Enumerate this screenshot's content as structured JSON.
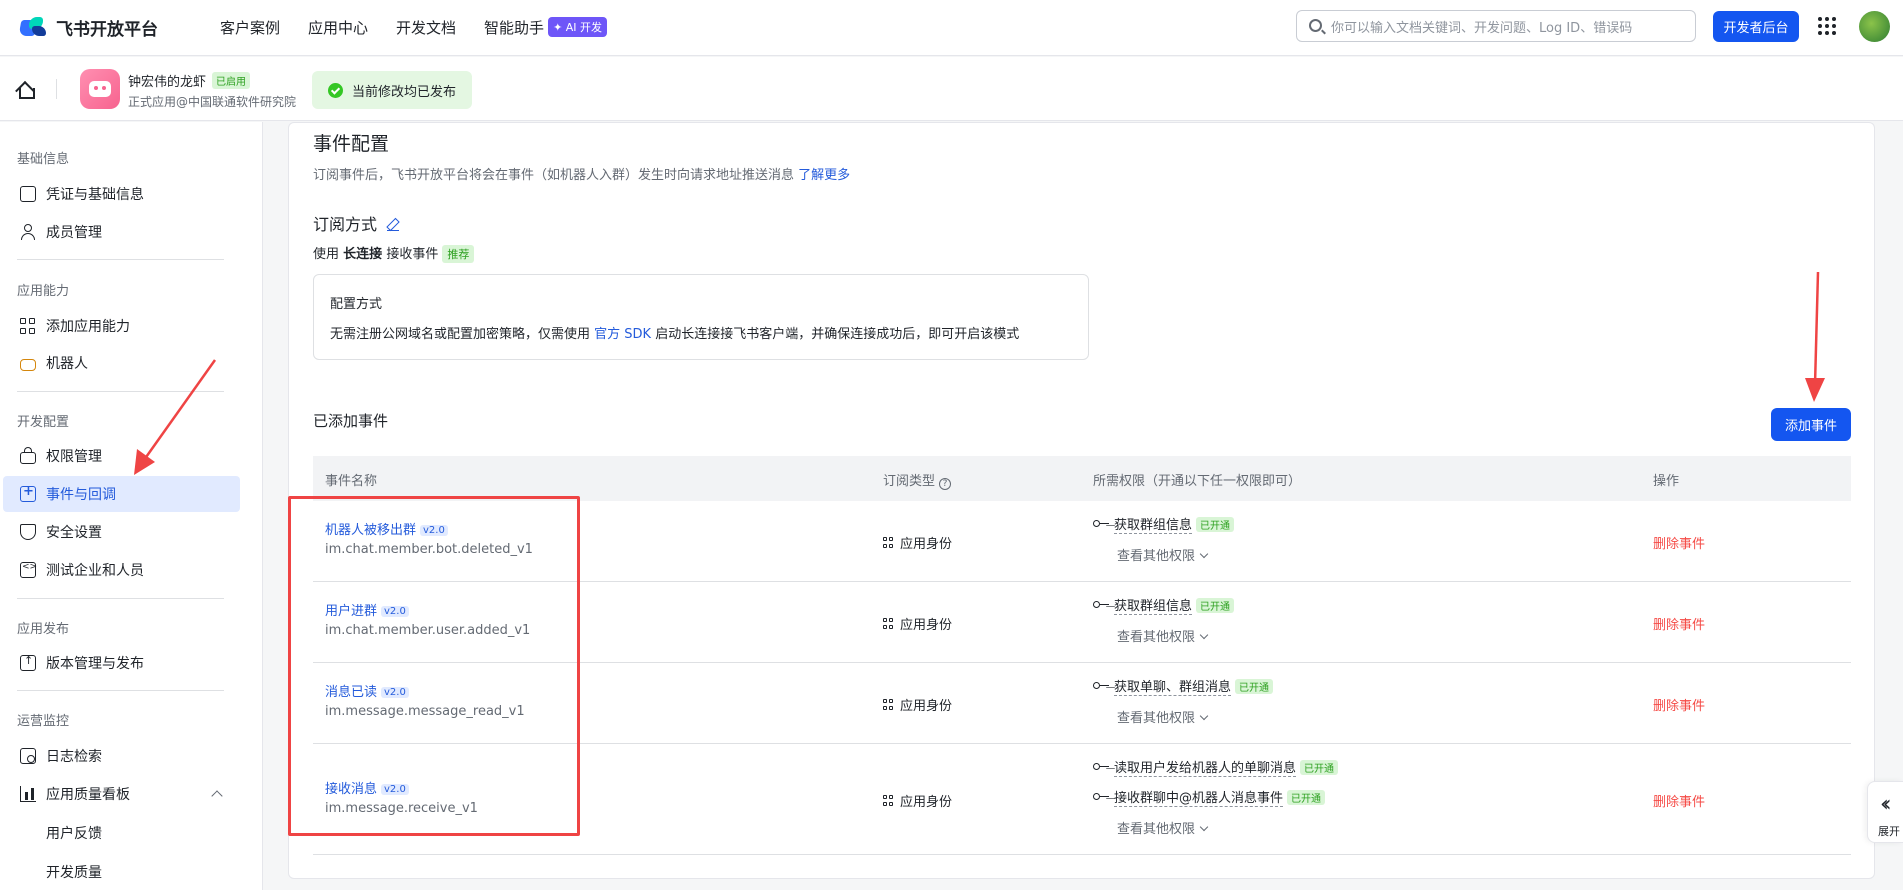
{
  "topnav": {
    "logo_text": "飞书开放平台",
    "links": [
      "客户案例",
      "应用中心",
      "开发文档",
      "智能助手"
    ],
    "ai_badge": "✦ AI 开发",
    "search_placeholder": "你可以输入文档关键词、开发问题、Log ID、错误码",
    "dev_console": "开发者后台"
  },
  "appbar": {
    "app_name": "钟宏伟的龙虾",
    "app_status": "已启用",
    "app_sub": "正式应用@中国联通软件研究院",
    "publish_status": "当前修改均已发布"
  },
  "sidebar": {
    "groups": [
      "基础信息",
      "应用能力",
      "开发配置",
      "应用发布",
      "运营监控"
    ],
    "items": {
      "credentials": "凭证与基础信息",
      "members": "成员管理",
      "add_capability": "添加应用能力",
      "robot": "机器人",
      "permissions": "权限管理",
      "events": "事件与回调",
      "security": "安全设置",
      "test_enterprise": "测试企业和人员",
      "versions": "版本管理与发布",
      "log_search": "日志检索",
      "quality_board": "应用质量看板",
      "user_feedback": "用户反馈",
      "dev_quality": "开发质量"
    }
  },
  "main": {
    "title": "事件配置",
    "desc": "订阅事件后，飞书开放平台将会在事件（如机器人入群）发生时向请求地址推送消息",
    "learn_more": "了解更多",
    "subscribe_title": "订阅方式",
    "mode_prefix": "使用",
    "mode_bold": "长连接",
    "mode_suffix": "接收事件",
    "mode_tag": "推荐",
    "cfg_title": "配置方式",
    "cfg_text_1": "无需注册公网域名或配置加密策略，仅需使用",
    "cfg_link": "官方 SDK",
    "cfg_text_2": "启动长连接接飞书客户端，并确保连接成功后，即可开启该模式",
    "added_title": "已添加事件",
    "add_button": "添加事件",
    "table_headers": [
      "事件名称",
      "订阅类型",
      "所需权限（开通以下任一权限即可）",
      "操作"
    ],
    "rows": [
      {
        "name": "机器人被移出群",
        "version": "v2.0",
        "key": "im.chat.member.bot.deleted_v1",
        "type": "应用身份",
        "perms": [
          "获取群组信息"
        ],
        "perm_tag": "已开通",
        "more": "查看其他权限",
        "action": "删除事件"
      },
      {
        "name": "用户进群",
        "version": "v2.0",
        "key": "im.chat.member.user.added_v1",
        "type": "应用身份",
        "perms": [
          "获取群组信息"
        ],
        "perm_tag": "已开通",
        "more": "查看其他权限",
        "action": "删除事件"
      },
      {
        "name": "消息已读",
        "version": "v2.0",
        "key": "im.message.message_read_v1",
        "type": "应用身份",
        "perms": [
          "获取单聊、群组消息"
        ],
        "perm_tag": "已开通",
        "more": "查看其他权限",
        "action": "删除事件"
      },
      {
        "name": "接收消息",
        "version": "v2.0",
        "key": "im.message.receive_v1",
        "type": "应用身份",
        "perms": [
          "读取用户发给机器人的单聊消息",
          "接收群聊中@机器人消息事件"
        ],
        "perm_tag": "已开通",
        "more": "查看其他权限",
        "action": "删除事件"
      }
    ]
  },
  "expand_handle": "展开",
  "colors": {
    "primary": "#1456f0",
    "link": "#245bdb",
    "danger": "#f54a45",
    "success": "#2ea121",
    "annotation": "#ef4444"
  }
}
